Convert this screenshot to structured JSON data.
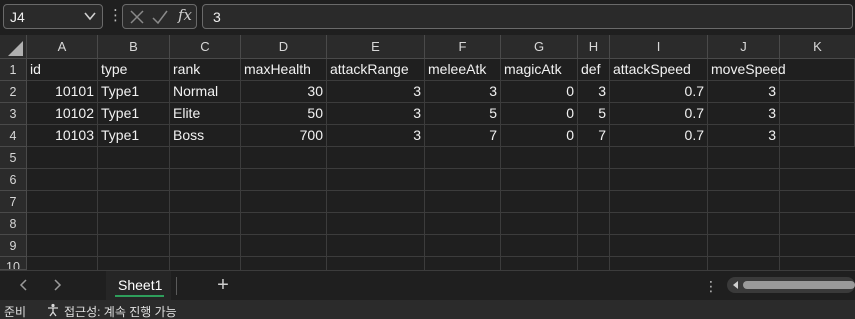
{
  "formula_bar": {
    "name_box": "J4",
    "formula_value": "3",
    "fx_label": "fx"
  },
  "columns": [
    "A",
    "B",
    "C",
    "D",
    "E",
    "F",
    "G",
    "H",
    "I",
    "J",
    "K"
  ],
  "rows": [
    "1",
    "2",
    "3",
    "4",
    "5",
    "6",
    "7",
    "8",
    "9",
    "10"
  ],
  "table": {
    "headers": [
      "id",
      "type",
      "rank",
      "maxHealth",
      "attackRange",
      "meleeAtk",
      "magicAtk",
      "def",
      "attackSpeed",
      "moveSpeed"
    ],
    "data": [
      [
        "10101",
        "Type1",
        "Normal",
        "30",
        "3",
        "3",
        "0",
        "3",
        "0.7",
        "3"
      ],
      [
        "10102",
        "Type1",
        "Elite",
        "50",
        "3",
        "5",
        "0",
        "5",
        "0.7",
        "3"
      ],
      [
        "10103",
        "Type1",
        "Boss",
        "700",
        "3",
        "7",
        "0",
        "7",
        "0.7",
        "3"
      ]
    ]
  },
  "sheet_tabs": {
    "active": "Sheet1",
    "add_label": "+"
  },
  "status_bar": {
    "ready": "준비",
    "accessibility": "접근성: 계속 진행 가능"
  },
  "colors": {
    "background": "#1f1f1f",
    "header_bg": "#2b2b2b",
    "accent_tab": "#2e9e5b"
  }
}
